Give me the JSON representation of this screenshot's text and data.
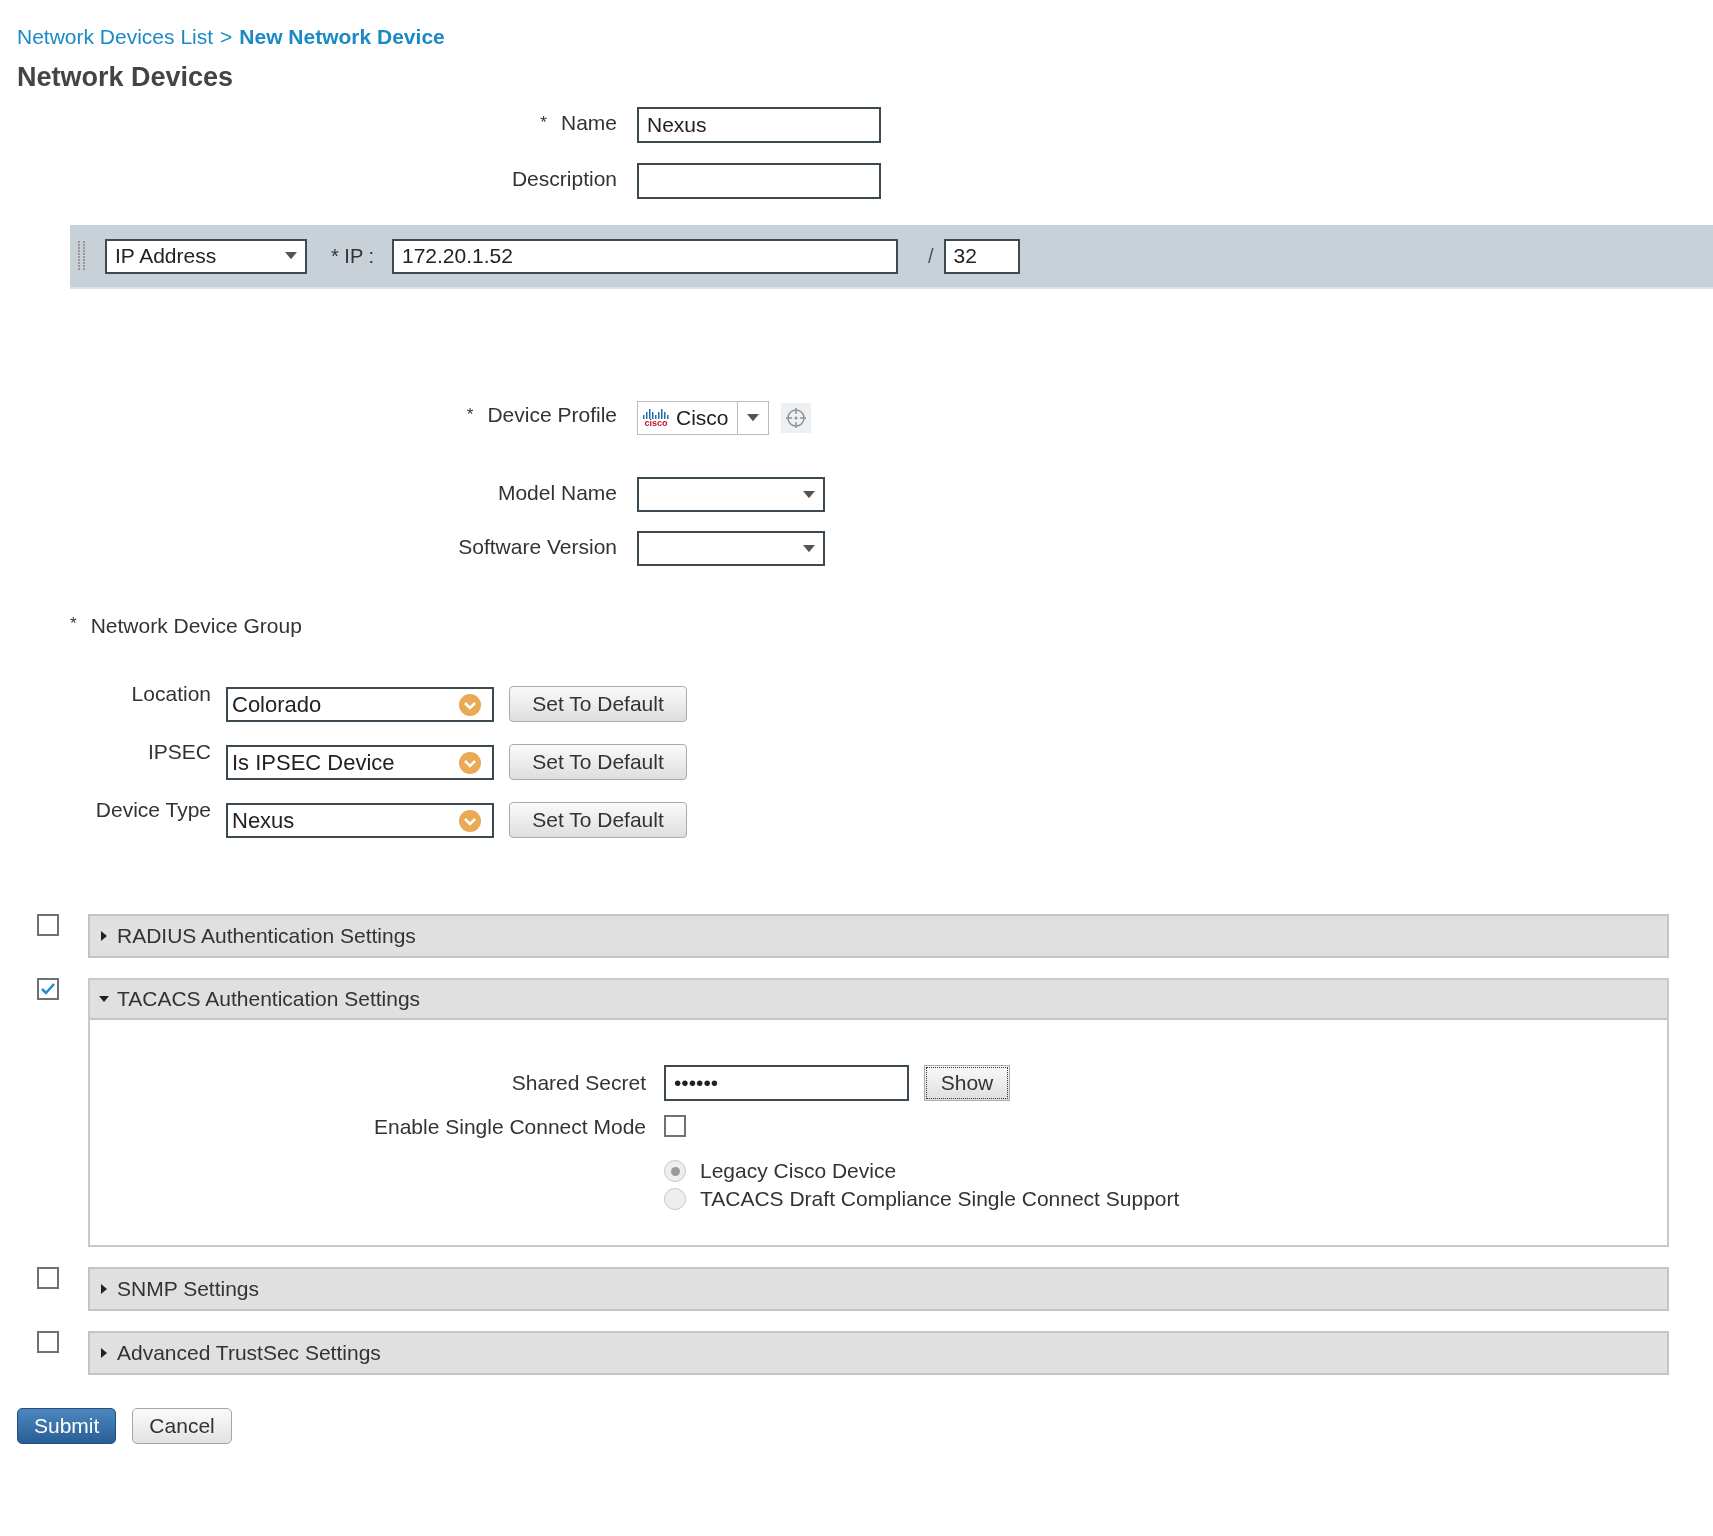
{
  "breadcrumb": {
    "link": "Network Devices List",
    "separator": ">",
    "current": "New Network Device"
  },
  "title": "Network Devices",
  "identity_fields": [
    {
      "mark": "*",
      "label": "Name",
      "value": "Nexus"
    },
    {
      "label": "Description"
    }
  ],
  "ip_row": {
    "type": "IP Address",
    "ip_label": "* IP :",
    "ip": "172.20.1.52",
    "separator": "/",
    "mask": "32"
  },
  "device_profile": {
    "mark": "*",
    "label": "Device Profile",
    "logo_text": "cisco",
    "value": "Cisco"
  },
  "selects": [
    {
      "label": "Model Name"
    },
    {
      "label": "Software Version"
    }
  ],
  "device_group": {
    "mark": "*",
    "title": "Network Device Group",
    "rows": [
      {
        "label": "Location",
        "value": "Colorado",
        "button": "Set To Default"
      },
      {
        "label": "IPSEC",
        "value": "Is IPSEC Device",
        "button": "Set To Default"
      },
      {
        "label": "Device Type",
        "value": "Nexus",
        "button": "Set To Default"
      }
    ]
  },
  "sections": [
    {
      "title": "RADIUS Authentication Settings",
      "checked": false,
      "expanded": false
    },
    {
      "title": "TACACS Authentication Settings",
      "checked": true,
      "expanded": true,
      "content": {
        "shared_secret": {
          "label": "Shared Secret",
          "value": "••••••",
          "button": "Show"
        },
        "single_connect": {
          "label": "Enable Single Connect Mode",
          "checked": false
        },
        "modes": [
          {
            "label": "Legacy Cisco Device",
            "selected": true
          },
          {
            "label": "TACACS Draft Compliance Single Connect Support",
            "selected": false
          }
        ]
      }
    },
    {
      "title": "SNMP Settings",
      "checked": false,
      "expanded": false
    },
    {
      "title": "Advanced TrustSec Settings",
      "checked": false,
      "expanded": false
    }
  ],
  "buttons": [
    {
      "label": "Submit",
      "kind": "primary"
    },
    {
      "label": "Cancel",
      "kind": "secondary"
    }
  ]
}
